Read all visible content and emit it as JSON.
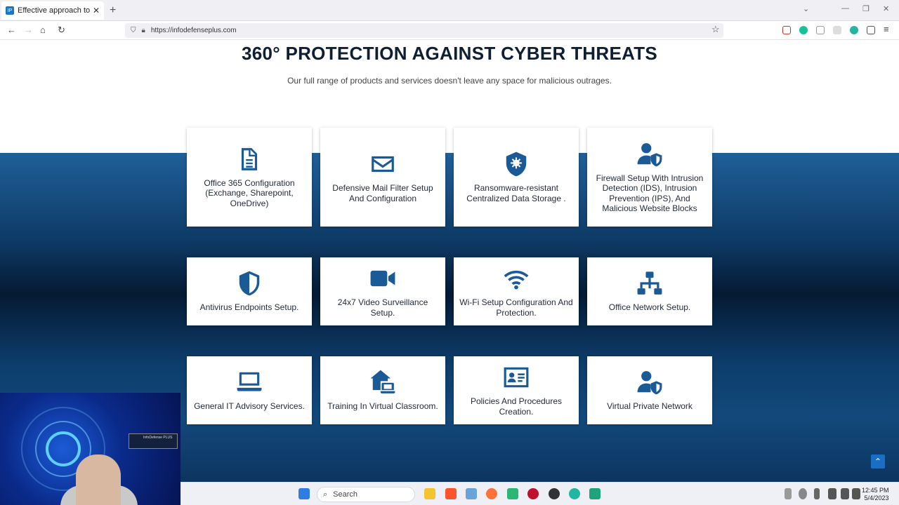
{
  "browser": {
    "tab_title": "Effective approach to your cybe",
    "favicon_text": "IP",
    "tab_close": "✕",
    "new_tab": "+",
    "url": "https://infodefenseplus.com",
    "nav": {
      "back": "←",
      "forward": "→",
      "home": "⌂",
      "reload": "↻"
    },
    "window": {
      "list": "⌄",
      "minimize": "—",
      "restore": "❐",
      "close": "✕"
    },
    "tools": {
      "star": "☆",
      "menu": "≡"
    }
  },
  "page": {
    "title": "360° PROTECTION AGAINST CYBER THREATS",
    "subtitle": "Our full range of products and services doesn't leave any space for malicious outrages.",
    "cards": [
      {
        "label": "Office 365 Configuration (Exchange, Sharepoint, OneDrive)",
        "icon": "document-icon"
      },
      {
        "label": "Defensive Mail Filter Setup And Configuration",
        "icon": "envelope-icon"
      },
      {
        "label": "Ransomware-resistant Centralized Data Storage .",
        "icon": "shield-virus-icon"
      },
      {
        "label": "Firewall Setup With Intrusion Detection (IDS), Intrusion Prevention (IPS), And Malicious Website Blocks",
        "icon": "user-shield-icon"
      },
      {
        "label": "Antivirus Endpoints Setup.",
        "icon": "shield-icon"
      },
      {
        "label": "24x7 Video Surveillance Setup.",
        "icon": "video-camera-icon"
      },
      {
        "label": "Wi-Fi Setup Configuration And Protection.",
        "icon": "wifi-icon"
      },
      {
        "label": "Office Network Setup.",
        "icon": "network-icon"
      },
      {
        "label": "General IT Advisory Services.",
        "icon": "laptop-icon"
      },
      {
        "label": "Training In Virtual Classroom.",
        "icon": "house-laptop-icon"
      },
      {
        "label": "Policies And Procedures Creation.",
        "icon": "id-card-icon"
      },
      {
        "label": "Virtual Private Network",
        "icon": "user-shield-icon"
      }
    ],
    "scroll_top": "⌃"
  },
  "webcam": {
    "logo_text": "InfoDefense PLUS"
  },
  "taskbar": {
    "search_placeholder": "Search",
    "time": "12:45 PM",
    "date": "5/4/2023"
  },
  "colors": {
    "accent": "#1a5a96",
    "title": "#0f1f33"
  }
}
